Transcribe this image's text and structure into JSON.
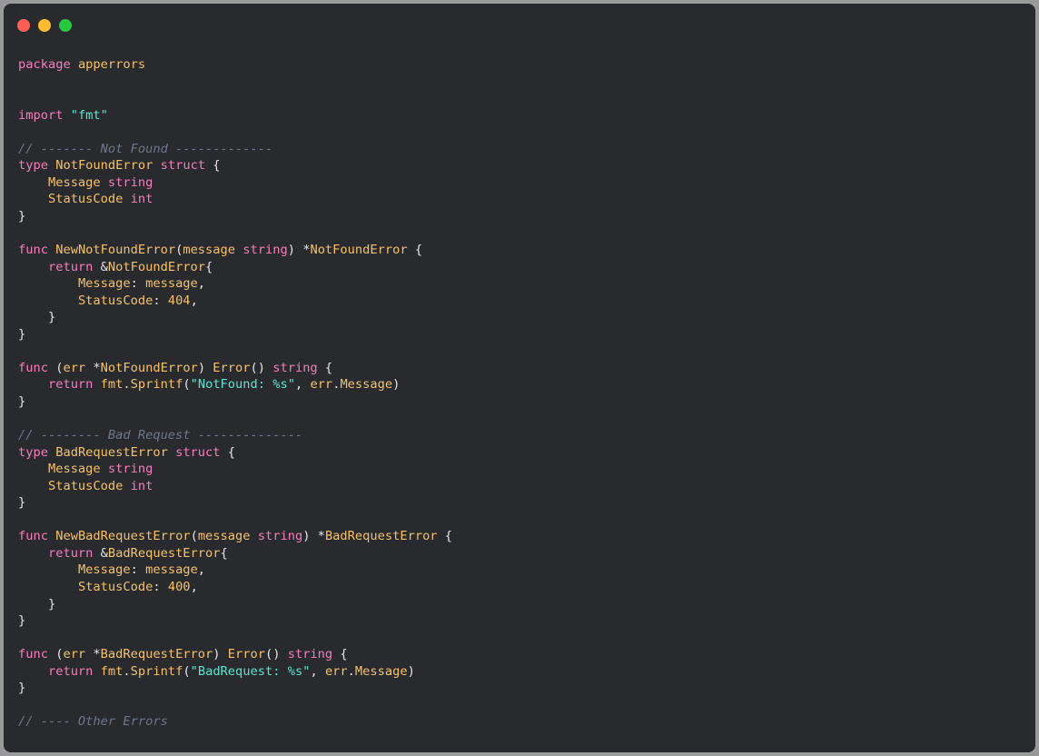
{
  "window": {
    "controls": [
      {
        "name": "close-button",
        "color": "#fe5f57"
      },
      {
        "name": "minimize-button",
        "color": "#febc2e"
      },
      {
        "name": "maximize-button",
        "color": "#28c840"
      }
    ]
  },
  "colors": {
    "background": "#282a2e",
    "keyword": "#f47fb9",
    "identifier": "#f5c26b",
    "string": "#5ee6d0",
    "comment": "#6e7787",
    "text": "#e6e6e6"
  },
  "code": {
    "language": "go",
    "lines": [
      [
        [
          "kw",
          "package"
        ],
        [
          "p",
          " "
        ],
        [
          "n",
          "apperrors"
        ]
      ],
      [],
      [],
      [
        [
          "kw",
          "import"
        ],
        [
          "p",
          " "
        ],
        [
          "s",
          "\"fmt\""
        ]
      ],
      [],
      [
        [
          "c",
          "// ------- Not Found -------------"
        ]
      ],
      [
        [
          "kw",
          "type"
        ],
        [
          "p",
          " "
        ],
        [
          "n",
          "NotFoundError"
        ],
        [
          "p",
          " "
        ],
        [
          "kw",
          "struct"
        ],
        [
          "p",
          " {"
        ]
      ],
      [
        [
          "p",
          "    "
        ],
        [
          "n",
          "Message"
        ],
        [
          "p",
          " "
        ],
        [
          "kw",
          "string"
        ]
      ],
      [
        [
          "p",
          "    "
        ],
        [
          "n",
          "StatusCode"
        ],
        [
          "p",
          " "
        ],
        [
          "kw",
          "int"
        ]
      ],
      [
        [
          "p",
          "}"
        ]
      ],
      [],
      [
        [
          "kw",
          "func"
        ],
        [
          "p",
          " "
        ],
        [
          "n",
          "NewNotFoundError"
        ],
        [
          "p",
          "("
        ],
        [
          "n",
          "message"
        ],
        [
          "p",
          " "
        ],
        [
          "kw",
          "string"
        ],
        [
          "p",
          ") *"
        ],
        [
          "n",
          "NotFoundError"
        ],
        [
          "p",
          " {"
        ]
      ],
      [
        [
          "p",
          "    "
        ],
        [
          "kw",
          "return"
        ],
        [
          "p",
          " &"
        ],
        [
          "n",
          "NotFoundError"
        ],
        [
          "p",
          "{"
        ]
      ],
      [
        [
          "p",
          "        "
        ],
        [
          "n",
          "Message"
        ],
        [
          "p",
          ": "
        ],
        [
          "n",
          "message"
        ],
        [
          "p",
          ","
        ]
      ],
      [
        [
          "p",
          "        "
        ],
        [
          "n",
          "StatusCode"
        ],
        [
          "p",
          ": "
        ],
        [
          "num",
          "404"
        ],
        [
          "p",
          ","
        ]
      ],
      [
        [
          "p",
          "    }"
        ]
      ],
      [
        [
          "p",
          "}"
        ]
      ],
      [],
      [
        [
          "kw",
          "func"
        ],
        [
          "p",
          " ("
        ],
        [
          "n",
          "err"
        ],
        [
          "p",
          " *"
        ],
        [
          "n",
          "NotFoundError"
        ],
        [
          "p",
          ") "
        ],
        [
          "n",
          "Error"
        ],
        [
          "p",
          "() "
        ],
        [
          "kw",
          "string"
        ],
        [
          "p",
          " {"
        ]
      ],
      [
        [
          "p",
          "    "
        ],
        [
          "kw",
          "return"
        ],
        [
          "p",
          " "
        ],
        [
          "n",
          "fmt"
        ],
        [
          "p",
          "."
        ],
        [
          "n",
          "Sprintf"
        ],
        [
          "p",
          "("
        ],
        [
          "s",
          "\"NotFound: %s\""
        ],
        [
          "p",
          ", "
        ],
        [
          "n",
          "err"
        ],
        [
          "p",
          "."
        ],
        [
          "n",
          "Message"
        ],
        [
          "p",
          ")"
        ]
      ],
      [
        [
          "p",
          "}"
        ]
      ],
      [],
      [
        [
          "c",
          "// -------- Bad Request --------------"
        ]
      ],
      [
        [
          "kw",
          "type"
        ],
        [
          "p",
          " "
        ],
        [
          "n",
          "BadRequestError"
        ],
        [
          "p",
          " "
        ],
        [
          "kw",
          "struct"
        ],
        [
          "p",
          " {"
        ]
      ],
      [
        [
          "p",
          "    "
        ],
        [
          "n",
          "Message"
        ],
        [
          "p",
          " "
        ],
        [
          "kw",
          "string"
        ]
      ],
      [
        [
          "p",
          "    "
        ],
        [
          "n",
          "StatusCode"
        ],
        [
          "p",
          " "
        ],
        [
          "kw",
          "int"
        ]
      ],
      [
        [
          "p",
          "}"
        ]
      ],
      [],
      [
        [
          "kw",
          "func"
        ],
        [
          "p",
          " "
        ],
        [
          "n",
          "NewBadRequestError"
        ],
        [
          "p",
          "("
        ],
        [
          "n",
          "message"
        ],
        [
          "p",
          " "
        ],
        [
          "kw",
          "string"
        ],
        [
          "p",
          ") *"
        ],
        [
          "n",
          "BadRequestError"
        ],
        [
          "p",
          " {"
        ]
      ],
      [
        [
          "p",
          "    "
        ],
        [
          "kw",
          "return"
        ],
        [
          "p",
          " &"
        ],
        [
          "n",
          "BadRequestError"
        ],
        [
          "p",
          "{"
        ]
      ],
      [
        [
          "p",
          "        "
        ],
        [
          "n",
          "Message"
        ],
        [
          "p",
          ": "
        ],
        [
          "n",
          "message"
        ],
        [
          "p",
          ","
        ]
      ],
      [
        [
          "p",
          "        "
        ],
        [
          "n",
          "StatusCode"
        ],
        [
          "p",
          ": "
        ],
        [
          "num",
          "400"
        ],
        [
          "p",
          ","
        ]
      ],
      [
        [
          "p",
          "    }"
        ]
      ],
      [
        [
          "p",
          "}"
        ]
      ],
      [],
      [
        [
          "kw",
          "func"
        ],
        [
          "p",
          " ("
        ],
        [
          "n",
          "err"
        ],
        [
          "p",
          " *"
        ],
        [
          "n",
          "BadRequestError"
        ],
        [
          "p",
          ") "
        ],
        [
          "n",
          "Error"
        ],
        [
          "p",
          "() "
        ],
        [
          "kw",
          "string"
        ],
        [
          "p",
          " {"
        ]
      ],
      [
        [
          "p",
          "    "
        ],
        [
          "kw",
          "return"
        ],
        [
          "p",
          " "
        ],
        [
          "n",
          "fmt"
        ],
        [
          "p",
          "."
        ],
        [
          "n",
          "Sprintf"
        ],
        [
          "p",
          "("
        ],
        [
          "s",
          "\"BadRequest: %s\""
        ],
        [
          "p",
          ", "
        ],
        [
          "n",
          "err"
        ],
        [
          "p",
          "."
        ],
        [
          "n",
          "Message"
        ],
        [
          "p",
          ")"
        ]
      ],
      [
        [
          "p",
          "}"
        ]
      ],
      [],
      [
        [
          "c",
          "// ---- Other Errors"
        ]
      ]
    ]
  }
}
